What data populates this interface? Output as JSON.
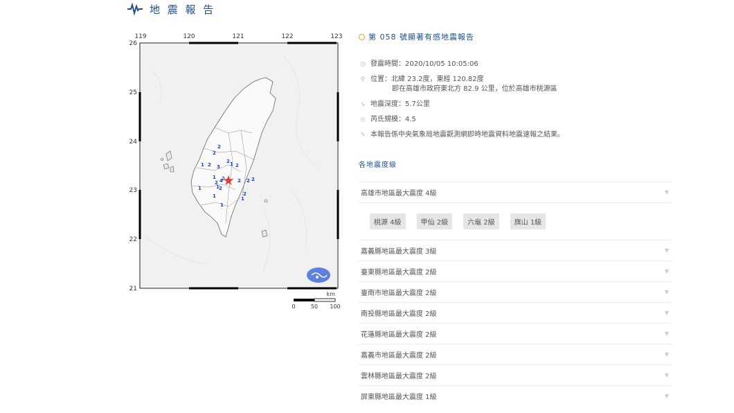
{
  "header": {
    "title": "地 震 報 告",
    "icon": "seismograph-icon"
  },
  "map": {
    "lon_ticks": [
      "119",
      "120",
      "121",
      "122",
      "123"
    ],
    "lat_ticks": [
      "26",
      "25",
      "24",
      "23",
      "22",
      "21"
    ],
    "scale_unit": "km",
    "scale_labels": [
      "0",
      "50",
      "100"
    ],
    "epicenter_color": "#e53935",
    "intensity_color": "#1a3fd0",
    "intensity_markers": [
      "2",
      "2",
      "2",
      "1",
      "3",
      "2",
      "1",
      "2",
      "2",
      "4",
      "2",
      "2",
      "2",
      "1",
      "2",
      "1",
      "2",
      "1",
      "1",
      "1",
      "2",
      "1"
    ]
  },
  "report": {
    "title": "第 058 號顯著有感地震報告",
    "time": "發震時間：2020/10/05 10:05:06",
    "location_1": "位置：北緯 23.2度，東經 120.82度",
    "location_2": "即在高雄市政府東北方 82.9 公里，位於高雄市桃源區",
    "depth": "地震深度：5.7公里",
    "magnitude": "芮氏規模：4.5",
    "note": "本報告係中央氣象局地震觀測網即時地震資料地震速報之結果。",
    "intensity_section": "各地震度級"
  },
  "regions": [
    {
      "label": "高雄市地區最大震度 4級",
      "expanded": true,
      "stations": [
        "桃源 4級",
        "甲仙 2級",
        "六龜 2級",
        "旗山 1級"
      ]
    },
    {
      "label": "嘉義縣地區最大震度 3級"
    },
    {
      "label": "臺東縣地區最大震度 2級"
    },
    {
      "label": "臺南市地區最大震度 2級"
    },
    {
      "label": "南投縣地區最大震度 2級"
    },
    {
      "label": "花蓮縣地區最大震度 2級"
    },
    {
      "label": "嘉義市地區最大震度 2級"
    },
    {
      "label": "雲林縣地區最大震度 2級"
    },
    {
      "label": "屏東縣地區最大震度 1級"
    }
  ]
}
